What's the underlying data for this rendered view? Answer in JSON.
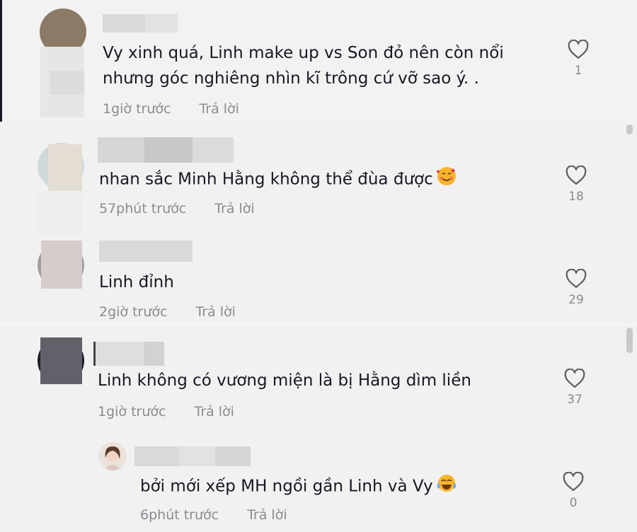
{
  "comments": [
    {
      "text": "Vy xinh quá, Linh make up vs Son đỏ nên còn nổi",
      "text2": "nhưng góc nghiêng nhìn kĩ trông cứ vỡ sao ý. .",
      "time": "1giờ trước",
      "reply_label": "Trả lời",
      "likes": "1"
    },
    {
      "text": "nhan sắc Minh Hằng không thể đùa được",
      "emoji": "smiling-face-with-hearts-icon",
      "time": "57phút trước",
      "reply_label": "Trả lời",
      "likes": "18"
    },
    {
      "text": "Linh đỉnh",
      "time": "2giờ trước",
      "reply_label": "Trả lời",
      "likes": "29"
    },
    {
      "text": "Linh không có vương miện là bị Hằng dìm liền",
      "time": "1giờ trước",
      "reply_label": "Trả lời",
      "likes": "37"
    }
  ],
  "reply": {
    "text": "bởi mới xếp MH ngồi gần Linh và Vy",
    "emoji": "tears-of-joy-icon",
    "time": "6phút trước",
    "reply_label": "Trả lời",
    "likes": "0"
  },
  "colors": {
    "text": "#161823",
    "muted": "#8a8b91",
    "background": "#f1f1f1"
  }
}
